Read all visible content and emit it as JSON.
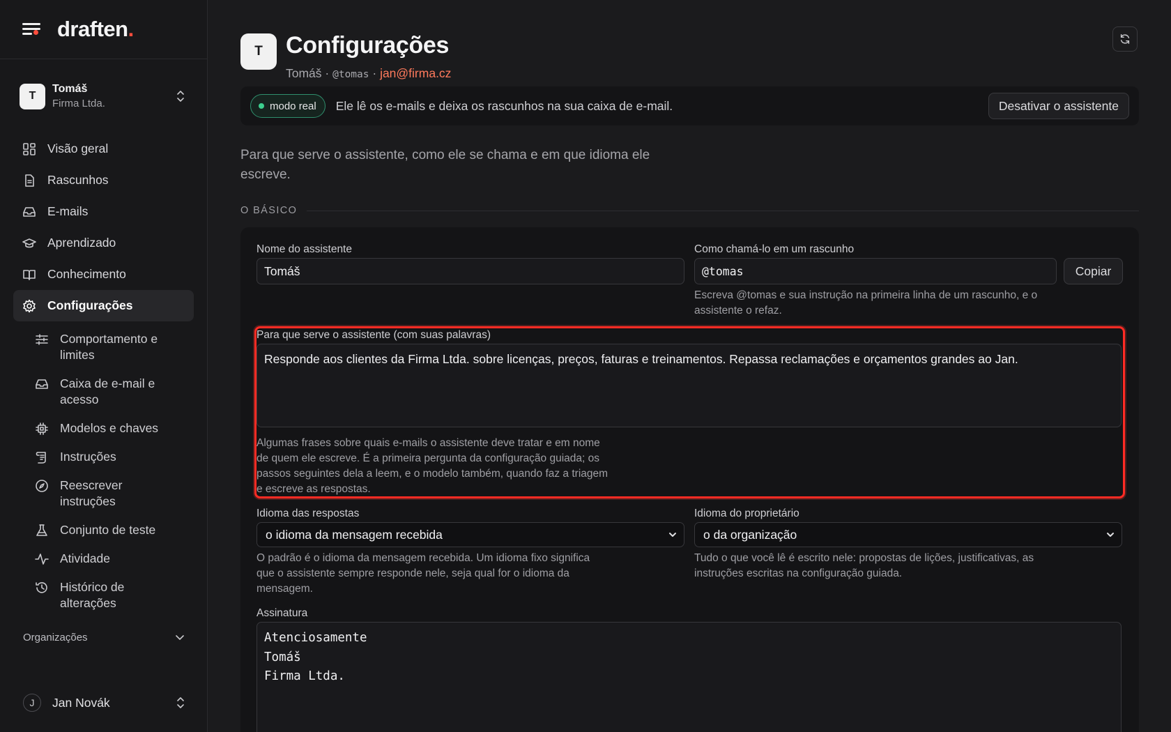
{
  "brand": {
    "name": "draften",
    "accent": "."
  },
  "account": {
    "initial": "T",
    "name": "Tomáš",
    "org": "Firma Ltda."
  },
  "nav": {
    "items": [
      {
        "label": "Visão geral",
        "icon": "grid-icon"
      },
      {
        "label": "Rascunhos",
        "icon": "document-icon"
      },
      {
        "label": "E-mails",
        "icon": "inbox-icon"
      },
      {
        "label": "Aprendizado",
        "icon": "graduation-cap-icon"
      },
      {
        "label": "Conhecimento",
        "icon": "book-icon"
      },
      {
        "label": "Configurações",
        "icon": "gear-icon",
        "active": true
      }
    ],
    "sub_items": [
      {
        "label": "Comportamento e limites",
        "icon": "sliders-icon"
      },
      {
        "label": "Caixa de e-mail e acesso",
        "icon": "inbox-icon"
      },
      {
        "label": "Modelos e chaves",
        "icon": "chip-icon"
      },
      {
        "label": "Instruções",
        "icon": "scroll-icon"
      },
      {
        "label": "Reescrever instruções",
        "icon": "compass-icon"
      },
      {
        "label": "Conjunto de teste",
        "icon": "flask-icon"
      },
      {
        "label": "Atividade",
        "icon": "activity-icon"
      },
      {
        "label": "Histórico de alterações",
        "icon": "history-icon"
      }
    ],
    "organizations_label": "Organizações"
  },
  "user": {
    "initial": "J",
    "name": "Jan Novák"
  },
  "header": {
    "initial": "T",
    "title": "Configurações",
    "name": "Tomáš",
    "separator": " · ",
    "handle": "@tomas",
    "email": "jan@firma.cz"
  },
  "banner": {
    "badge": "modo real",
    "text": "Ele lê os e-mails e deixa os rascunhos na sua caixa de e-mail.",
    "button": "Desativar o assistente"
  },
  "intro": "Para que serve o assistente, como ele se chama e em que idioma ele escreve.",
  "section": "O BÁSICO",
  "form": {
    "name_label": "Nome do assistente",
    "name_value": "Tomáš",
    "handle_label": "Como chamá-lo em um rascunho",
    "handle_value": "@tomas",
    "copy_button": "Copiar",
    "handle_help": "Escreva @tomas e sua instrução na primeira linha de um rascunho, e o assistente o refaz.",
    "purpose_label": "Para que serve o assistente (com suas palavras)",
    "purpose_value": "Responde aos clientes da Firma Ltda. sobre licenças, preços, faturas e treinamentos. Repassa reclamações e orçamentos grandes ao Jan.",
    "purpose_help": "Algumas frases sobre quais e-mails o assistente deve tratar e em nome de quem ele escreve. É a primeira pergunta da configuração guiada; os passos seguintes dela a leem, e o modelo também, quando faz a triagem e escreve as respostas.",
    "reply_lang_label": "Idioma das respostas",
    "reply_lang_value": "o idioma da mensagem recebida",
    "reply_lang_help": "O padrão é o idioma da mensagem recebida. Um idioma fixo significa que o assistente sempre responde nele, seja qual for o idioma da mensagem.",
    "owner_lang_label": "Idioma do proprietário",
    "owner_lang_value": "o da organização",
    "owner_lang_help": "Tudo o que você lê é escrito nele: propostas de lições, justificativas, as instruções escritas na configuração guiada.",
    "signature_label": "Assinatura",
    "signature_lines": [
      "Atenciosamente",
      "Tomáš",
      "Firma Ltda."
    ]
  },
  "colors": {
    "accent": "#ff4d3d",
    "email": "#ff7a5c",
    "live": "#3ccf8e",
    "highlight": "#ff2b24"
  }
}
